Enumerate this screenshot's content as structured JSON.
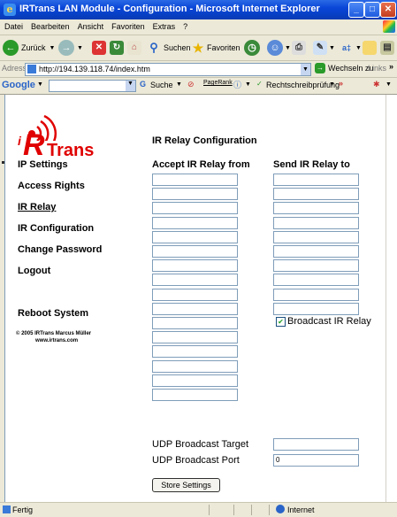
{
  "window": {
    "title": "IRTrans LAN Module - Configuration - Microsoft Internet Explorer",
    "minimize": "_",
    "maximize": "□",
    "close": "✕"
  },
  "menu": [
    "Datei",
    "Bearbeiten",
    "Ansicht",
    "Favoriten",
    "Extras",
    "?"
  ],
  "toolbar": {
    "back": "Zurück",
    "search": "Suchen",
    "favorites": "Favoriten"
  },
  "address": {
    "label": "Adresse",
    "url": "http://194.139.118.74/index.htm",
    "go": "Wechseln zu",
    "links": "Links",
    "more": "»"
  },
  "google": {
    "brand": "Google",
    "search": "Suche",
    "pagerank": "PageRank",
    "spell": "Rechtschreibprüfung",
    "more": "»"
  },
  "logo": {
    "i": "i",
    "r": "R",
    "trans": "Trans"
  },
  "nav": [
    "IP Settings",
    "Access Rights",
    "IR Relay",
    "IR Configuration",
    "Change Password",
    "Logout"
  ],
  "reboot": "Reboot System",
  "copyright": "© 2005 IRTrans Marcus Müller",
  "website": "www.irtrans.com",
  "main": {
    "heading": "IR Relay Configuration",
    "accept_header": "Accept IR Relay from",
    "send_header": "Send IR Relay to",
    "accept_fields": [
      "",
      "",
      "",
      "",
      "",
      "",
      "",
      "",
      "",
      "",
      "",
      "",
      "",
      "",
      "",
      ""
    ],
    "send_fields": [
      "",
      "",
      "",
      "",
      "",
      "",
      "",
      "",
      "",
      ""
    ],
    "broadcast_label": "Broadcast IR Relay",
    "broadcast_checked": true,
    "udp_target_label": "UDP Broadcast Target",
    "udp_target_value": "",
    "udp_port_label": "UDP Broadcast Port",
    "udp_port_value": "0",
    "store_button": "Store Settings"
  },
  "status": {
    "text": "Fertig",
    "zone": "Internet"
  },
  "colors": {
    "titlebar": "#0a46d8",
    "logo_red": "#e00000",
    "window_bg": "#ece9d8"
  }
}
